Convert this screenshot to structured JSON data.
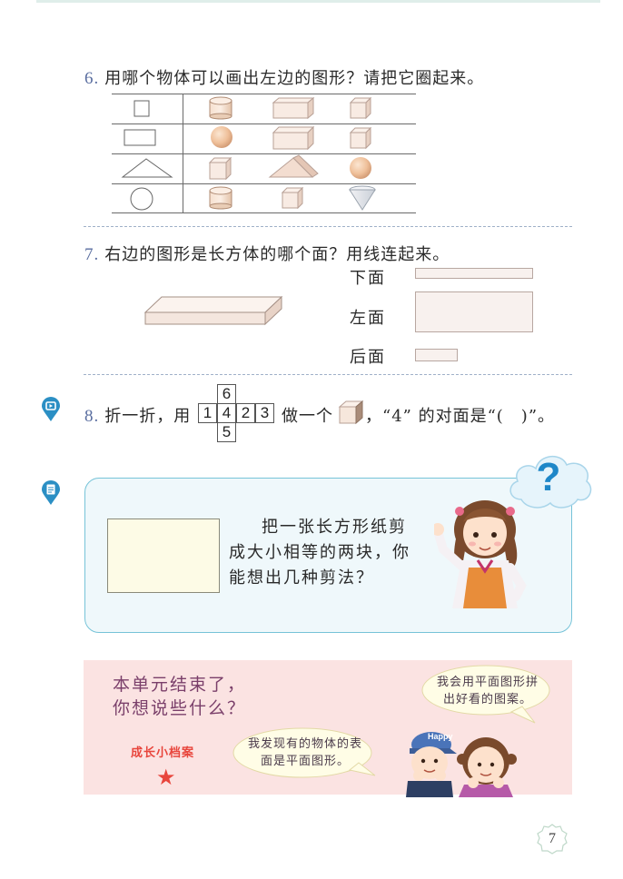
{
  "q6": {
    "num": "6.",
    "text": "用哪个物体可以画出左边的图形？请把它圈起来。"
  },
  "q7": {
    "num": "7.",
    "text": "右边的图形是长方体的哪个面？用线连起来。",
    "faces": [
      "下面",
      "左面",
      "后面"
    ]
  },
  "q8": {
    "num": "8.",
    "pre": "折一折，用",
    "mid": "做一个",
    "post": "，“4” 的对面是“(　)”。",
    "net": [
      "6",
      "1",
      "4",
      "2",
      "3",
      "5"
    ]
  },
  "think": {
    "text": "把一张长方形纸剪成大小相等的两块，你能想出几种剪法？",
    "mark": "?"
  },
  "summary": {
    "title": "本单元结束了，你想说些什么？",
    "badge": "成长小档案",
    "star": "★",
    "bubble_right": "我会用平面图形拼出好看的图案。",
    "bubble_left": "我发现有的物体的表面是平面图形。",
    "cap_text": "Happy"
  },
  "page_number": "7",
  "colors": {
    "accent": "#5a6ea0",
    "panel_border": "#76c3d8",
    "pink_bg": "#fbe3e2",
    "badge": "#e8453c",
    "pin": "#2b8fc4"
  }
}
